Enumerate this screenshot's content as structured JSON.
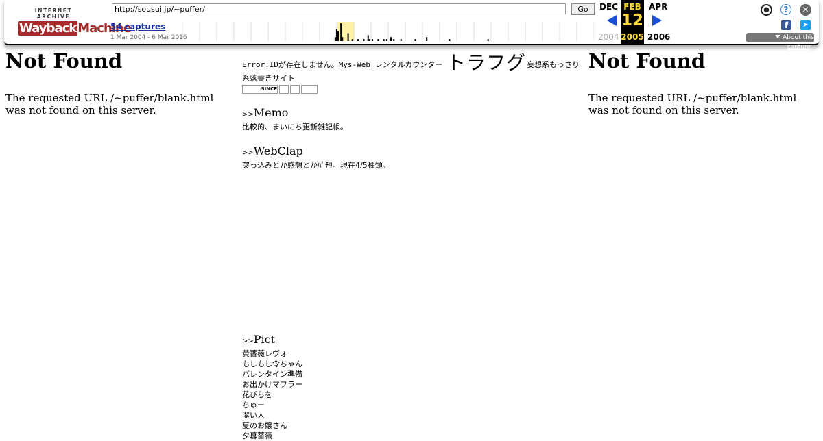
{
  "toolbar": {
    "logo_top": "INTERNET ARCHIVE",
    "logo_wayback": "Wayback",
    "logo_machine": "Machine",
    "url_value": "http://sousui.jp/~puffer/",
    "go_label": "Go",
    "captures_label": "54 captures",
    "capture_range": "1 Mar 2004 - 6 Mar 2016",
    "calendar": {
      "prev_month": "DEC",
      "current_month": "FEB",
      "next_month": "APR",
      "current_day": "12",
      "prev_year": "2004",
      "current_year": "2005",
      "next_year": "2006"
    },
    "about_label": "About this capture",
    "icons": {
      "user": "user-icon",
      "help": "help-icon",
      "close": "close-icon",
      "facebook": "facebook-icon",
      "twitter": "twitter-icon"
    },
    "sparkline": {
      "years": 12,
      "highlight_year_index": 9,
      "bars": [
        {
          "year": 8,
          "month": 10,
          "count": 2
        },
        {
          "year": 8,
          "month": 11,
          "count": 6
        },
        {
          "year": 9,
          "month": 0,
          "count": 5
        },
        {
          "year": 9,
          "month": 2,
          "count": 9
        },
        {
          "year": 9,
          "month": 3,
          "count": 2
        },
        {
          "year": 9,
          "month": 7,
          "count": 4
        },
        {
          "year": 9,
          "month": 10,
          "count": 1
        },
        {
          "year": 10,
          "month": 2,
          "count": 1
        },
        {
          "year": 10,
          "month": 6,
          "count": 1
        },
        {
          "year": 10,
          "month": 9,
          "count": 3
        },
        {
          "year": 10,
          "month": 10,
          "count": 1
        },
        {
          "year": 11,
          "month": 0,
          "count": 1
        },
        {
          "year": 11,
          "month": 4,
          "count": 1
        },
        {
          "year": 11,
          "month": 8,
          "count": 1
        },
        {
          "year": 11,
          "month": 10,
          "count": 1
        },
        {
          "year": 12,
          "month": 1,
          "count": 2
        },
        {
          "year": 12,
          "month": 3,
          "count": 1
        },
        {
          "year": 12,
          "month": 8,
          "count": 1
        },
        {
          "year": 13,
          "month": 6,
          "count": 1
        },
        {
          "year": 14,
          "month": 2,
          "count": 2
        },
        {
          "year": 15,
          "month": 6,
          "count": 1
        },
        {
          "year": 17,
          "month": 9,
          "count": 1
        }
      ]
    }
  },
  "frames": {
    "left": {
      "title": "Not Found",
      "message": "The requested URL /~puffer/blank.html was not found on this server."
    },
    "right": {
      "title": "Not Found",
      "message": "The requested URL /~puffer/blank.html was not found on this server."
    }
  },
  "center": {
    "error_text": "Error:IDが存在しません。Mys-Web レンタルカウンター",
    "site_title": "トラフグ",
    "tagline": "妄想系もっさり",
    "tagline2": "系落書きサイト",
    "badge_since": "SINCE",
    "memo": {
      "marker": ">>",
      "title": "Memo",
      "desc": "比較的、まいにち更新雑記帳。"
    },
    "webclap": {
      "marker": ">>",
      "title": "WebClap",
      "desc": "突っ込みとか感想とかﾊﾟﾁﾘ。現在4/5種類。"
    },
    "pict": {
      "marker": ">>",
      "title": "Pict",
      "items": [
        "黄薔薇レヴォ",
        "もしもし令ちゃん",
        "バレンタイン準備",
        "お出かけマフラー",
        "花びらを",
        "ちゅー",
        "潔い人",
        "夏のお嬢さん",
        "夕暮薔薇"
      ]
    }
  }
}
